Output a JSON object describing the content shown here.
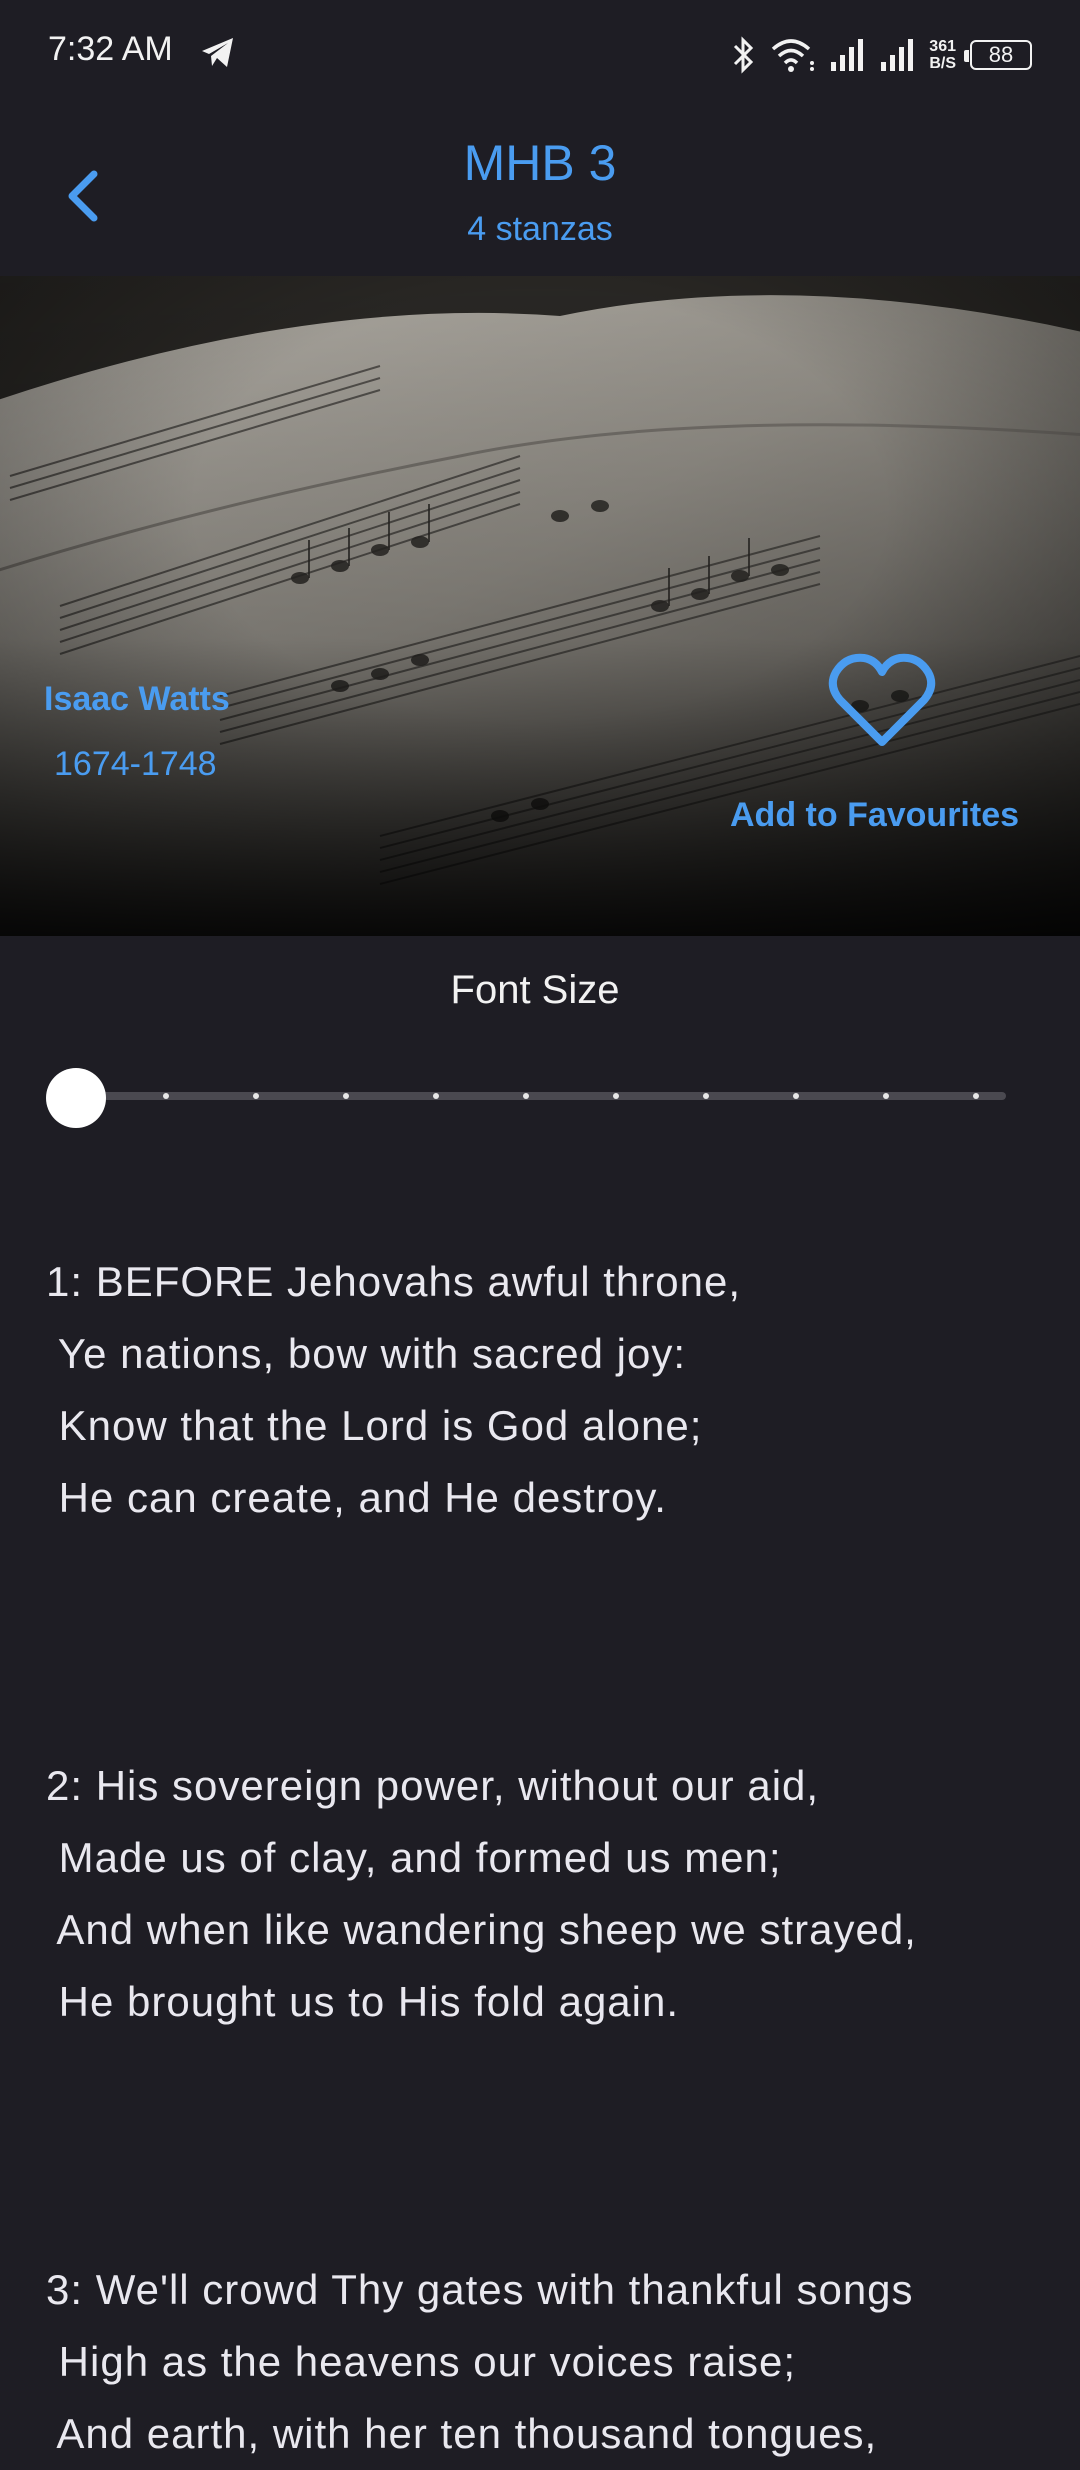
{
  "status_bar": {
    "time": "7:32 AM",
    "speed_value": "361",
    "speed_unit": "B/S",
    "battery": "88"
  },
  "header": {
    "title": "MHB 3",
    "subtitle": "4 stanzas"
  },
  "hero": {
    "author": "Isaac Watts",
    "years": "1674-1748",
    "favourite_label": "Add to Favourites"
  },
  "font_size": {
    "label": "Font Size",
    "level": 0,
    "steps": 11
  },
  "stanzas": [
    {
      "lines": [
        "1: BEFORE Jehovahs awful throne,",
        " Ye nations, bow with sacred joy:",
        " Know that the Lord is God alone;",
        " He can create, and He destroy."
      ]
    },
    {
      "lines": [
        "2: His sovereign power, without our aid,",
        " Made us of clay, and formed us men;",
        " And when like wandering sheep we strayed,",
        " He brought us to His fold again."
      ]
    },
    {
      "lines": [
        "3: We'll crowd Thy gates with thankful songs",
        " High as the heavens our voices raise;",
        " And earth, with her ten thousand tongues,"
      ]
    }
  ],
  "colors": {
    "background": "#1e1d24",
    "accent": "#4a9cf0",
    "text": "#e9e8ef"
  }
}
